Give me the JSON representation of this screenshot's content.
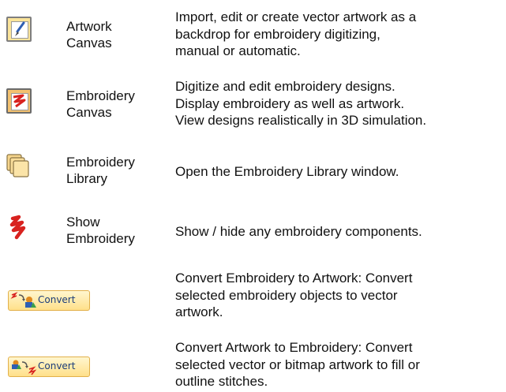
{
  "rows": [
    {
      "icon": "artwork-canvas-icon",
      "label": "Artwork\nCanvas",
      "description": "Import, edit or create vector artwork as a\nbackdrop for embroidery digitizing,\nmanual or automatic."
    },
    {
      "icon": "embroidery-canvas-icon",
      "label": "Embroidery\nCanvas",
      "description": "Digitize and edit embroidery designs.\nDisplay embroidery as well as artwork.\nView designs realistically in 3D simulation."
    },
    {
      "icon": "embroidery-library-icon",
      "label": "Embroidery\nLibrary",
      "description": "Open the Embroidery Library window."
    },
    {
      "icon": "show-embroidery-icon",
      "label": "Show\nEmbroidery",
      "description": "Show / hide any embroidery components."
    },
    {
      "icon": "convert-embroidery-to-artwork-icon",
      "button_label": "Convert",
      "description": "Convert Embroidery to Artwork: Convert\nselected embroidery objects to vector\nartwork."
    },
    {
      "icon": "convert-artwork-to-embroidery-icon",
      "button_label": "Convert",
      "description": "Convert Artwork to Embroidery: Convert\nselected vector or bitmap artwork to fill or\noutline stitches."
    }
  ],
  "colors": {
    "icon_gold": "#fbe49a",
    "icon_orange": "#f3c16f",
    "stitch_red": "#d8221f",
    "brush_blue": "#2f5fb3",
    "button_border": "#e2b04a",
    "button_text": "#1a3c7a"
  }
}
